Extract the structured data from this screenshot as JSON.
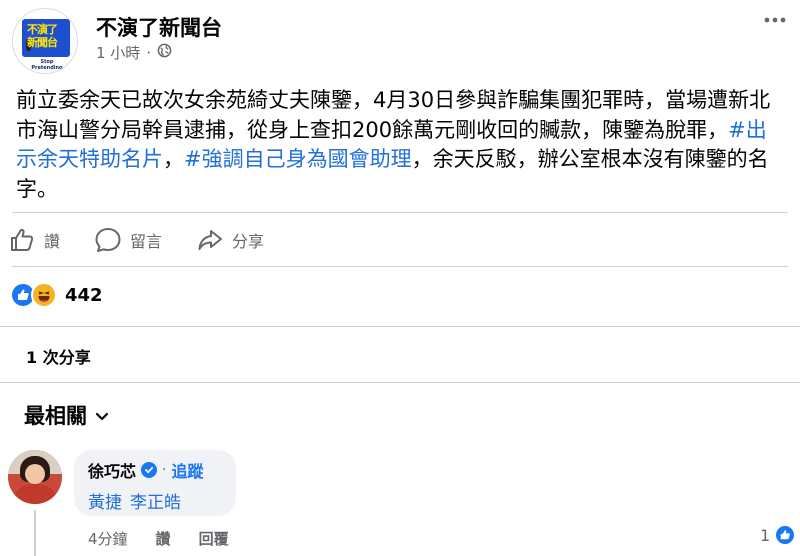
{
  "post": {
    "page_name": "不演了新聞台",
    "logo_text": "不演了 新聞台",
    "logo_subtext": "Stop Pretending",
    "time": "1 小時",
    "dot": "·",
    "text_parts": [
      "前立委余天已故次女余苑綺丈夫陳鑒，4月30日參與詐騙集團犯罪時，當場遭新北市海山警分局幹員逮捕，從身上查扣200餘萬元剛收回的贓款，陳鑒為脫罪，",
      "#出示余天特助名片",
      "，",
      "#強調自己身為國會助理",
      "，余天反駁，辦公室根本沒有陳鑒的名字。"
    ]
  },
  "actions": {
    "like_label": "讚",
    "comment_label": "留言",
    "share_label": "分享"
  },
  "reactions": {
    "count": "442"
  },
  "shares": {
    "label": "1 次分享"
  },
  "comments_section": {
    "sort_label": "最相關"
  },
  "comment": {
    "author": "徐巧芯",
    "separator": "·",
    "follow_label": "追蹤",
    "tags": [
      "黃捷",
      "李正皓"
    ],
    "time": "4分鐘",
    "like_label": "讚",
    "reply_label": "回覆",
    "reaction_count": "1"
  },
  "colors": {
    "accent": "#1877f2",
    "hashtag": "#216fdb",
    "muted": "#65676b",
    "bubble": "#f0f2f5"
  },
  "icons": [
    "more-options-icon",
    "globe-icon",
    "like-icon",
    "comment-icon",
    "share-icon",
    "like-reaction-icon",
    "haha-reaction-icon",
    "chevron-down-icon",
    "verified-badge-icon"
  ]
}
